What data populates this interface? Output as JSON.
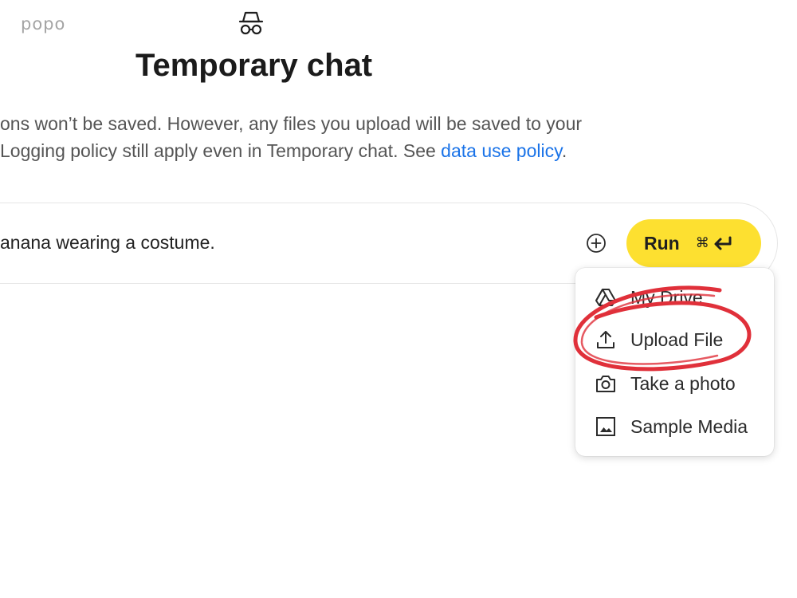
{
  "header": {
    "watermark": "popo",
    "title": "Temporary chat"
  },
  "notice": {
    "line1": "ons won’t be saved. However, any files you upload will be saved to your",
    "line2_before": " Logging policy still apply even in Temporary chat. See ",
    "link": "data use policy",
    "line2_after": "."
  },
  "prompt": {
    "text": "anana wearing a costume."
  },
  "run_button": {
    "label": "Run",
    "shortcut": "⌘"
  },
  "menu": {
    "items": [
      {
        "label": "My Drive",
        "icon": "drive-icon"
      },
      {
        "label": "Upload File",
        "icon": "upload-icon"
      },
      {
        "label": "Take a photo",
        "icon": "camera-icon"
      },
      {
        "label": "Sample Media",
        "icon": "image-icon"
      }
    ]
  },
  "colors": {
    "run_button": "#fde030",
    "link": "#1a73e8",
    "annotation_circle": "#e0303a"
  }
}
